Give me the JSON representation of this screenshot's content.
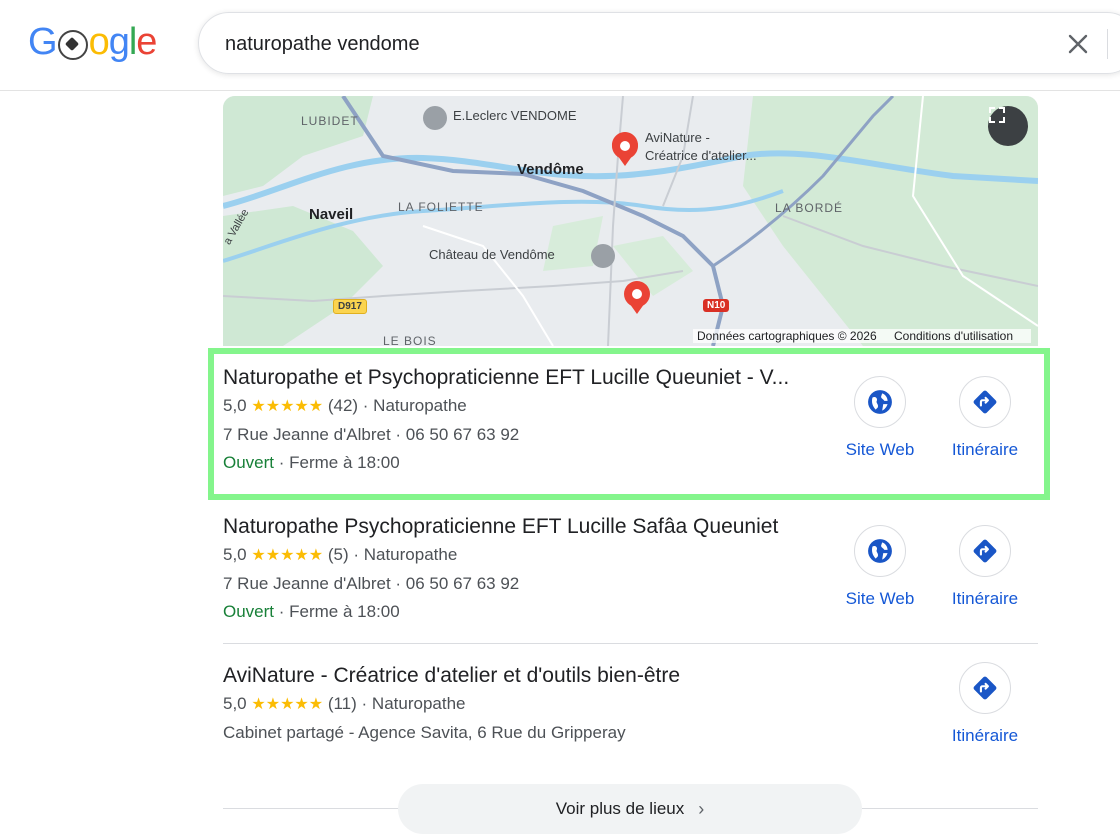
{
  "search": {
    "query": "naturopathe vendome"
  },
  "map": {
    "labels": {
      "lubidet": "LUBIDET",
      "leclerc": "E.Leclerc VENDOME",
      "avinature": "AviNature -",
      "avinature2": "Créatrice d'atelier...",
      "vendome": "Vendôme",
      "naveil": "Naveil",
      "foliette": "LA FOLIETTE",
      "borde": "LA BORDÉ",
      "chateau": "Château de Vendôme",
      "vallee": "a Vallée",
      "d917": "D917",
      "n10": "N10",
      "leBois": "LE BOIS"
    },
    "footer": {
      "data": "Données cartographiques © 2026",
      "terms": "Conditions d'utilisation"
    }
  },
  "results": [
    {
      "name": "Naturopathe et Psychopraticienne EFT Lucille Queuniet - V...",
      "rating": "5,0",
      "stars": "★★★★★",
      "reviews": "(42)",
      "category": "Naturopathe",
      "address": "7 Rue Jeanne d'Albret · 06 50 67 63 92",
      "status": "Ouvert",
      "hours": " · Ferme à 18:00",
      "website_label": "Site Web",
      "directions_label": "Itinéraire"
    },
    {
      "name": "Naturopathe Psychopraticienne EFT Lucille Safâa Queuniet",
      "rating": "5,0",
      "stars": "★★★★★",
      "reviews": "(5)",
      "category": "Naturopathe",
      "address": "7 Rue Jeanne d'Albret · 06 50 67 63 92",
      "status": "Ouvert",
      "hours": " · Ferme à 18:00",
      "website_label": "Site Web",
      "directions_label": "Itinéraire"
    },
    {
      "name": "AviNature - Créatrice d'atelier et d'outils bien-être",
      "rating": "5,0",
      "stars": "★★★★★",
      "reviews": "(11)",
      "category": "Naturopathe",
      "address": "Cabinet partagé - Agence Savita, 6 Rue du Gripperay",
      "directions_label": "Itinéraire"
    }
  ],
  "more_places": "Voir plus de lieux",
  "colors": {
    "link": "#1558d6",
    "open": "#188038",
    "star": "#fbbc04",
    "highlight": "#84f58c",
    "pin": "#ea4335"
  }
}
